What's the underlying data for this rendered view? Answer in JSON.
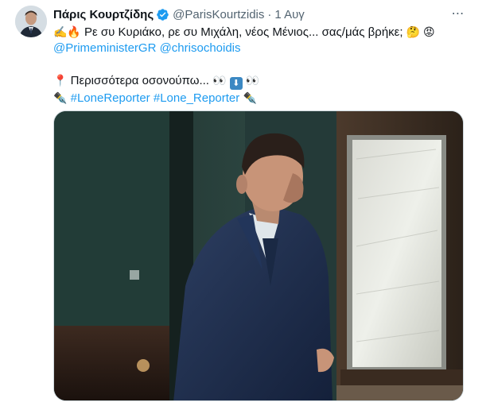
{
  "tweet": {
    "author_name": "Πάρις Κουρτζίδης",
    "handle": "@ParisKourtzidis",
    "separator": "·",
    "date": "1 Αυγ",
    "more_icon": "⋯",
    "text_line1_emoji": "✍️🔥",
    "text_line1": "Ρε συ Κυριάκο, ρε συ Μιχάλη, νέος Μένιος... σας/μάς βρήκε;",
    "text_line1_end_emoji": "🤔 😡",
    "mention1": "@PrimeministerGR",
    "mention2": "@chrisochoidis",
    "pin_emoji": "📍",
    "more_text": "Περισσότερα οσονούπω...",
    "eyes_emoji": "👀",
    "down_arrow": "⬇",
    "pen_emoji": "✒️",
    "hashtag1": "#LoneReporter",
    "hashtag2": "#Lone_Reporter"
  },
  "colors": {
    "link": "#1d9bf0",
    "verified": "#1d9bf0",
    "secondary_text": "#536471"
  },
  "icons": {
    "verified": "verified-badge-icon",
    "more": "more-options-icon"
  }
}
